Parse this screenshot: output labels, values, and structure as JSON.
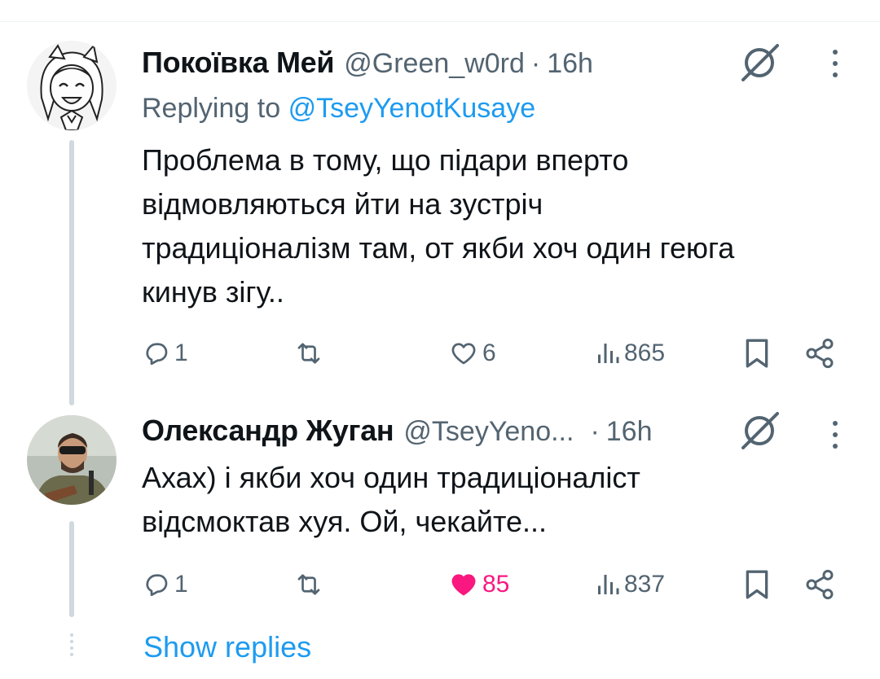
{
  "tweets": [
    {
      "name": "Покоївка Мей",
      "handle": "@Green_w0rd",
      "separator": "·",
      "time": "16h",
      "replying_prefix": "Replying to",
      "replying_to": "@TseyYenotKusaye",
      "text_lines": [
        "Проблема в тому, що підари вперто",
        "відмовляються йти на зустріч",
        "традиціоналізм там, от якби хоч один геюга",
        "кинув зігу.."
      ],
      "replies": "1",
      "retweets": "",
      "likes": "6",
      "liked": false,
      "views": "865"
    },
    {
      "name": "Олександр Жуган",
      "handle": "@TseyYeno...",
      "separator": "·",
      "time": "16h",
      "text_lines": [
        "Ахах) і якби хоч один традиціоналіст",
        "відсмоктав хуя. Ой, чекайте..."
      ],
      "replies": "1",
      "retweets": "",
      "likes": "85",
      "liked": true,
      "views": "837"
    }
  ],
  "show_replies": "Show replies",
  "colors": {
    "accent": "#1d9bf0",
    "like": "#f91880",
    "muted": "#536471",
    "text": "#0f1419",
    "thread_line": "#cfd9de"
  },
  "icons": [
    "grok-icon",
    "more-icon",
    "reply-icon",
    "retweet-icon",
    "like-icon",
    "views-icon",
    "bookmark-icon",
    "share-icon"
  ]
}
